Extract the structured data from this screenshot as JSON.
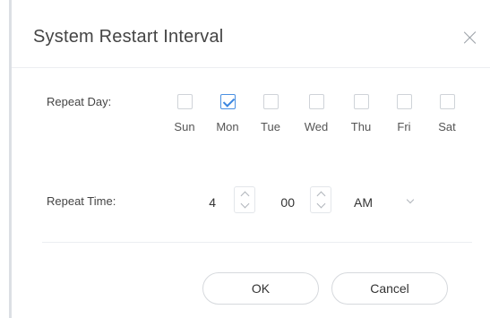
{
  "dialog": {
    "title": "System Restart Interval",
    "close_icon": "close-icon"
  },
  "repeat_day": {
    "label": "Repeat Day:",
    "days": [
      {
        "name": "Sun",
        "checked": false
      },
      {
        "name": "Mon",
        "checked": true
      },
      {
        "name": "Tue",
        "checked": false
      },
      {
        "name": "Wed",
        "checked": false
      },
      {
        "name": "Thu",
        "checked": false
      },
      {
        "name": "Fri",
        "checked": false
      },
      {
        "name": "Sat",
        "checked": false
      }
    ]
  },
  "repeat_time": {
    "label": "Repeat Time:",
    "hour": "4",
    "minute": "00",
    "period": "AM"
  },
  "buttons": {
    "ok": "OK",
    "cancel": "Cancel"
  },
  "colors": {
    "checkbox_checked": "#3b86e0",
    "border": "#d6d9dd"
  }
}
